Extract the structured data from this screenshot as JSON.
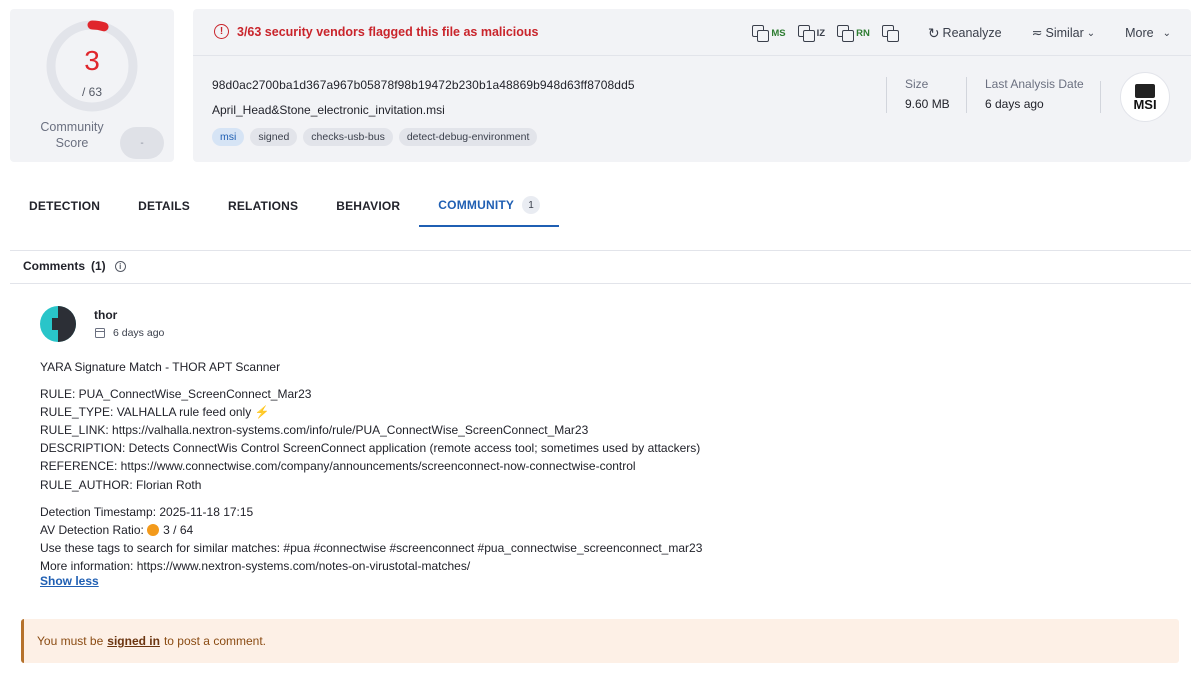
{
  "score": {
    "detections": "3",
    "total": "/ 63",
    "detection_fraction": 0.0476,
    "community_label": "Community Score",
    "community_value": "-"
  },
  "alert": {
    "text": "3/63 security vendors flagged this file as malicious",
    "icon": "alert-circle-icon",
    "color": "#c9242b"
  },
  "toolbar": {
    "copy_ms": "MS",
    "copy_iz": "IZ",
    "copy_rn": "RN",
    "reanalyze": "Reanalyze",
    "similar": "Similar",
    "more": "More"
  },
  "file": {
    "hash": "98d0ac2700ba1d367a967b05878f98b19472b230b1a48869b948d63ff8708dd5",
    "name": "April_Head&Stone_electronic_invitation.msi",
    "tags": [
      "msi",
      "signed",
      "checks-usb-bus",
      "detect-debug-environment"
    ],
    "size_label": "Size",
    "size_value": "9.60 MB",
    "date_label": "Last Analysis Date",
    "date_value": "6 days ago",
    "type_logo": "MSI"
  },
  "tabs": [
    {
      "label": "DETECTION"
    },
    {
      "label": "DETAILS"
    },
    {
      "label": "RELATIONS"
    },
    {
      "label": "BEHAVIOR"
    },
    {
      "label": "COMMUNITY",
      "badge": "1"
    }
  ],
  "comments": {
    "header": "Comments",
    "count": "(1)",
    "author": "thor",
    "date": "6 days ago",
    "lines": [
      "YARA Signature Match - THOR APT Scanner",
      "",
      "RULE: PUA_ConnectWise_ScreenConnect_Mar23",
      "RULE_TYPE: VALHALLA rule feed only ⚡",
      "RULE_LINK: https://valhalla.nextron-systems.com/info/rule/PUA_ConnectWise_ScreenConnect_Mar23",
      "DESCRIPTION: Detects ConnectWis Control ScreenConnect application (remote access tool; sometimes used by attackers)",
      "REFERENCE: https://www.connectwise.com/company/announcements/screenconnect-now-connectwise-control",
      "RULE_AUTHOR: Florian Roth",
      "",
      "Detection Timestamp: 2025-11-18 17:15",
      "AV Detection Ratio: 🟠 3 / 64",
      "Use these tags to search for similar matches: #pua #connectwise #screenconnect #pua_connectwise_screenconnect_mar23",
      "More information: https://www.nextron-systems.com/notes-on-virustotal-matches/"
    ],
    "show_less": "Show less"
  },
  "signin": {
    "prefix": "You must be",
    "link": "signed in",
    "suffix": "to post a comment."
  }
}
